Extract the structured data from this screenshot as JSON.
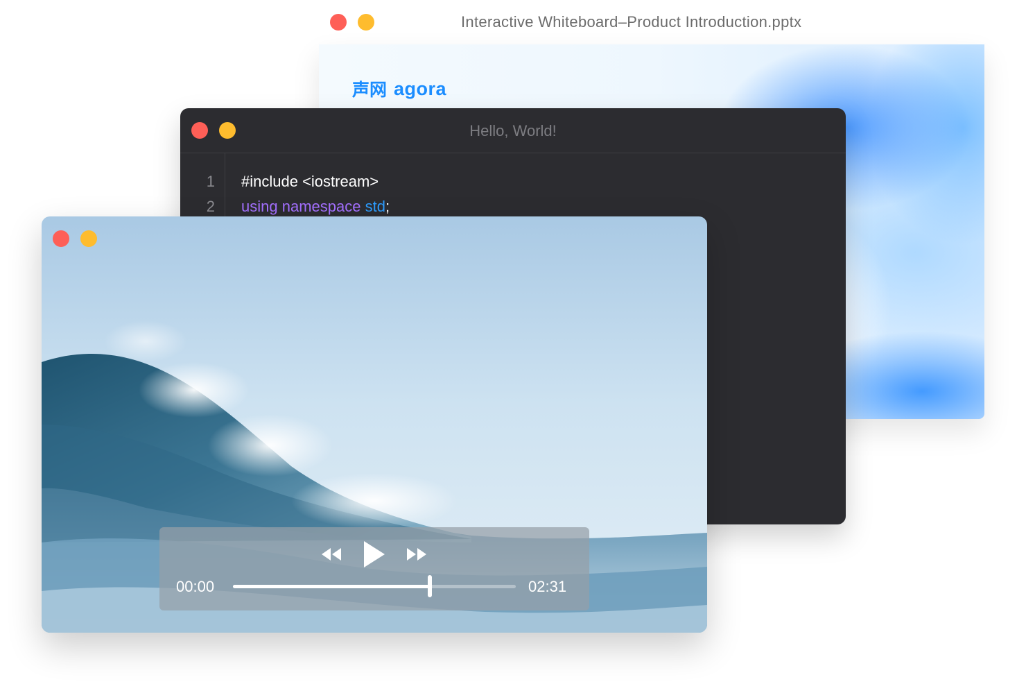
{
  "presentation_window": {
    "title": "Interactive Whiteboard–Product Introduction.pptx",
    "logo_cn": "声网",
    "logo_en": "agora",
    "logo_color": "#1b8dff"
  },
  "code_window": {
    "title": "Hello, World!",
    "lines": [
      {
        "number": "1",
        "text": "#include <iostream>"
      },
      {
        "number": "2",
        "keyword1": "using",
        "keyword2": "namespace",
        "identifier": "std",
        "punct": ";"
      }
    ],
    "colors": {
      "background": "#2c2c30",
      "keyword": "#a470ff",
      "namespace": "#2d9dff"
    }
  },
  "video_window": {
    "controls": {
      "rewind_icon": "rewind-icon",
      "play_icon": "play-icon",
      "fast_forward_icon": "fast-forward-icon",
      "current_time": "00:00",
      "duration": "02:31",
      "progress": 0.696
    }
  },
  "window_colors": {
    "close": "#fe5f57",
    "minimize": "#febc2e"
  }
}
